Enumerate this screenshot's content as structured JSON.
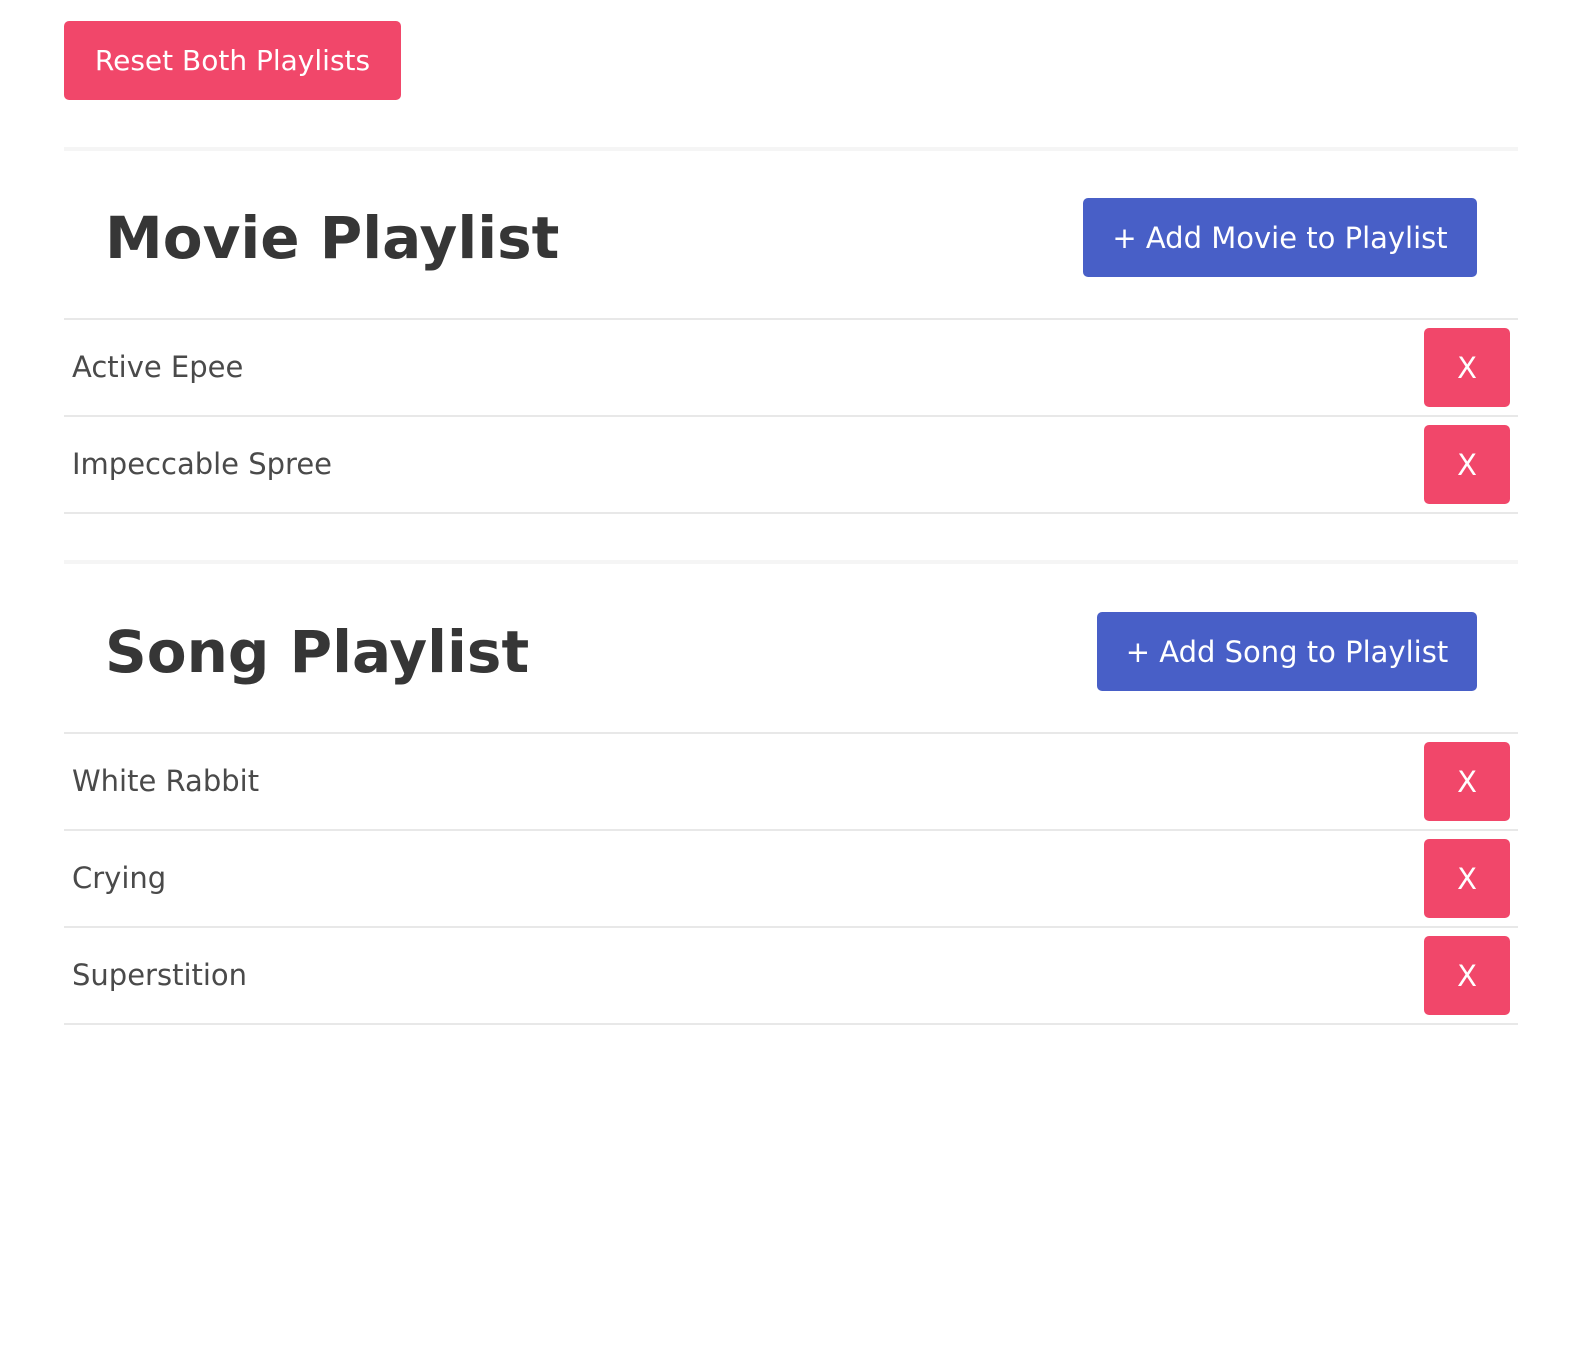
{
  "toolbar": {
    "reset_label": "Reset Both Playlists"
  },
  "movie_playlist": {
    "title": "Movie Playlist",
    "add_label": "+ Add Movie to Playlist",
    "items": [
      {
        "label": "Active Epee",
        "remove_label": "X"
      },
      {
        "label": "Impeccable Spree",
        "remove_label": "X"
      }
    ]
  },
  "song_playlist": {
    "title": "Song Playlist",
    "add_label": "+ Add Song to Playlist",
    "items": [
      {
        "label": "White Rabbit",
        "remove_label": "X"
      },
      {
        "label": "Crying",
        "remove_label": "X"
      },
      {
        "label": "Superstition",
        "remove_label": "X"
      }
    ]
  },
  "colors": {
    "danger": "#f1476a",
    "primary": "#485fc7",
    "text": "#363636",
    "divider": "#e8e8e8"
  }
}
